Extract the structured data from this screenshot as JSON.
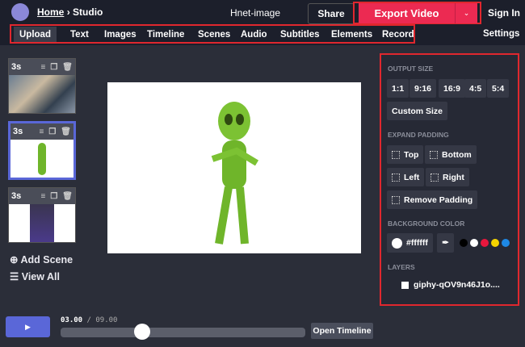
{
  "header": {
    "breadcrumb_home": "Home",
    "breadcrumb_sep": "›",
    "breadcrumb_current": "Studio",
    "project_title": "Hnet-image",
    "share": "Share",
    "export": "Export Video",
    "sign_in": "Sign In"
  },
  "tabs": [
    {
      "label": "Upload",
      "active": true
    },
    {
      "label": "Text"
    },
    {
      "label": "Images"
    },
    {
      "label": "Timeline"
    },
    {
      "label": "Scenes"
    },
    {
      "label": "Audio"
    },
    {
      "label": "Subtitles"
    },
    {
      "label": "Elements"
    },
    {
      "label": "Record"
    }
  ],
  "settings": "Settings",
  "scenes": [
    {
      "duration": "3s"
    },
    {
      "duration": "3s",
      "selected": true
    },
    {
      "duration": "3s"
    }
  ],
  "add_scene": "Add Scene",
  "view_all": "View All",
  "player": {
    "current": "03.00",
    "separator": "/",
    "total": "09.00",
    "progress": 0.333,
    "open_timeline": "Open Timeline"
  },
  "panel": {
    "output_size_label": "OUTPUT SIZE",
    "sizes": [
      "1:1",
      "9:16",
      "16:9",
      "4:5",
      "5:4"
    ],
    "custom_size": "Custom Size",
    "expand_padding_label": "EXPAND PADDING",
    "padding": [
      "Top",
      "Bottom",
      "Left",
      "Right",
      "Remove Padding"
    ],
    "background_color_label": "BACKGROUND COLOR",
    "bg_value": "#ffffff",
    "swatches": [
      "#000000",
      "#ffffff",
      "#e8173d",
      "#f5d400",
      "#1e88e5"
    ],
    "layers_label": "LAYERS",
    "layer": "giphy-qOV9n46J1o...."
  },
  "colors": {
    "accent": "#5a67d8",
    "export": "#ec2a52",
    "highlight": "#e0272e"
  }
}
